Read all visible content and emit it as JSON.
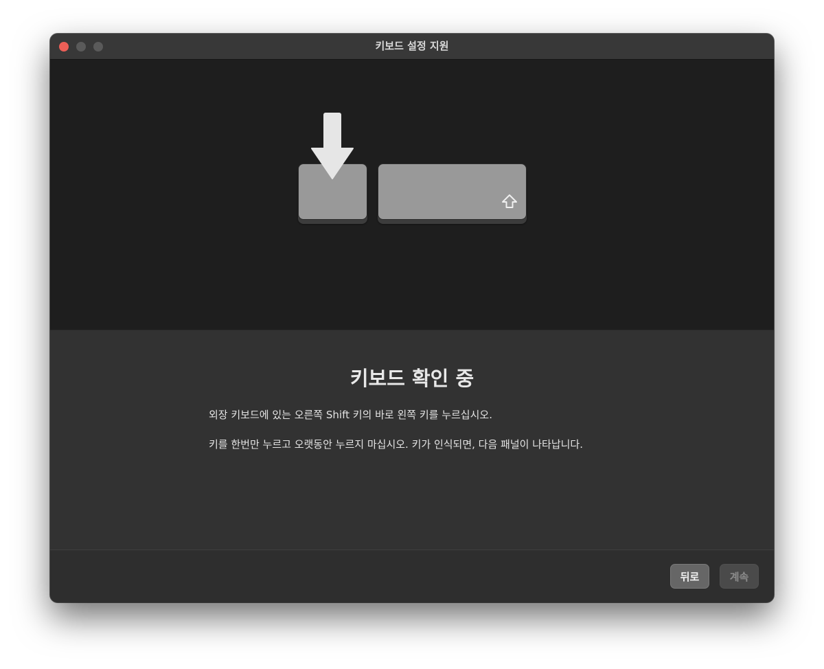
{
  "window": {
    "title": "키보드 설정 지원"
  },
  "illustration": {
    "arrow_icon": "down-arrow-icon",
    "shift_icon": "shift-icon"
  },
  "content": {
    "heading": "키보드 확인 중",
    "paragraph1": "외장 키보드에 있는 오른쪽 Shift 키의 바로 왼쪽 키를 누르십시오.",
    "paragraph2": "키를 한번만 누르고 오랫동안 누르지 마십시오. 키가 인식되면, 다음 패널이 나타납니다."
  },
  "footer": {
    "back_label": "뒤로",
    "continue_label": "계속"
  },
  "colors": {
    "close": "#ec5f57",
    "window_bg": "#323232",
    "illustration_bg": "#1e1e1e",
    "key": "#999999"
  }
}
